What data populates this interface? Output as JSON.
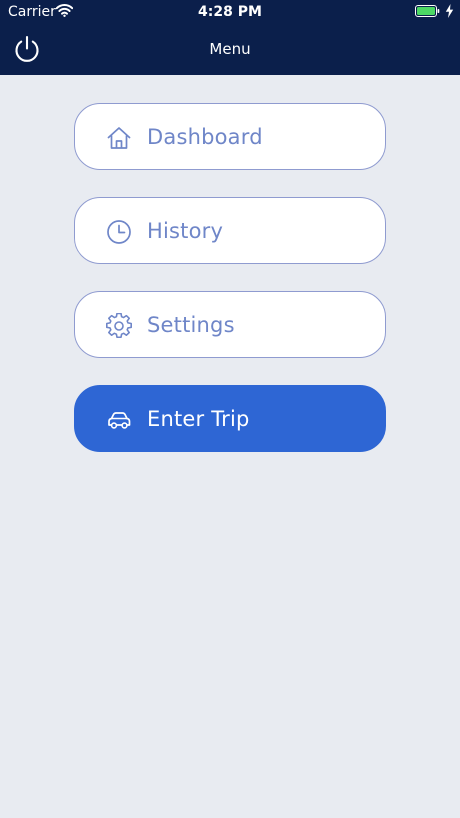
{
  "status_bar": {
    "carrier": "Carrier",
    "time": "4:28 PM"
  },
  "nav": {
    "title": "Menu",
    "left_icon": "power-icon"
  },
  "menu": {
    "items": [
      {
        "label": "Dashboard",
        "icon": "home-icon"
      },
      {
        "label": "History",
        "icon": "clock-icon"
      },
      {
        "label": "Settings",
        "icon": "gear-icon"
      },
      {
        "label": "Enter Trip",
        "icon": "car-icon",
        "primary": true
      }
    ]
  },
  "colors": {
    "nav_background": "#0b1f4b",
    "page_background": "#e8ebf1",
    "accent": "#2e66d4",
    "item_text": "#6f86c8",
    "item_border": "#8f9bd0"
  }
}
